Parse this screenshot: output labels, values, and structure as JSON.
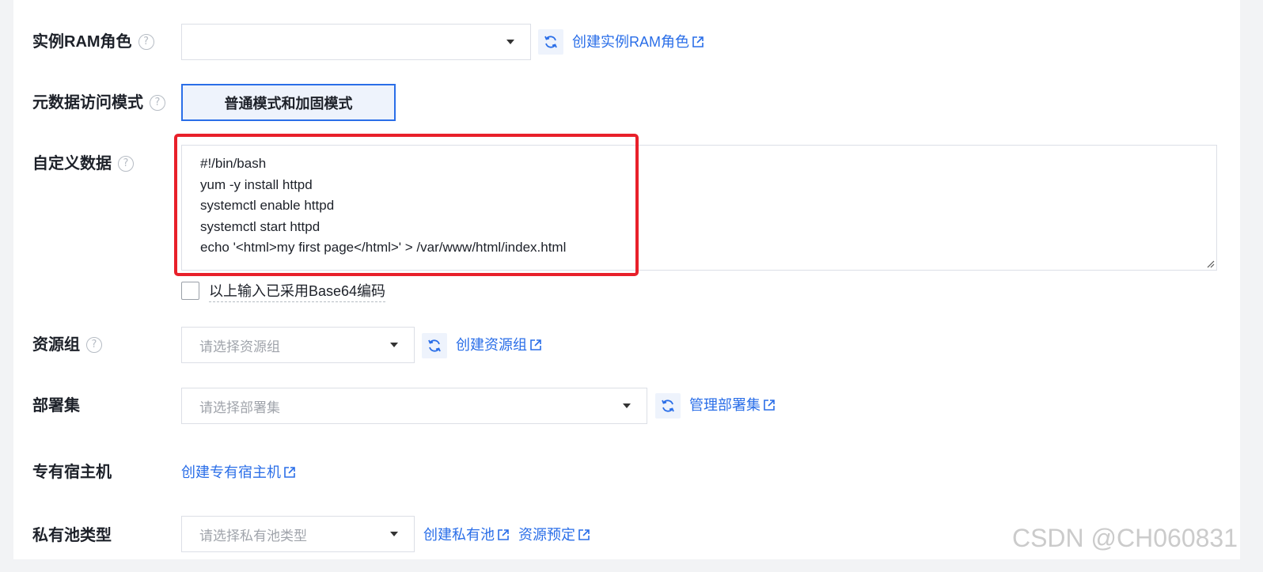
{
  "ram_role": {
    "label": "实例RAM角色",
    "value": "",
    "create_link": "创建实例RAM角色"
  },
  "metadata_mode": {
    "label": "元数据访问模式",
    "button_label": "普通模式和加固模式"
  },
  "user_data": {
    "label": "自定义数据",
    "lines": [
      "#!/bin/bash",
      "yum -y install httpd",
      "systemctl enable httpd",
      "systemctl start httpd",
      "echo '<html>my first page</html>' > /var/www/html/index.html"
    ],
    "base64_checkbox_label": "以上输入已采用Base64编码",
    "base64_checked": false
  },
  "resource_group": {
    "label": "资源组",
    "placeholder": "请选择资源组",
    "create_link": "创建资源组"
  },
  "deployment_set": {
    "label": "部署集",
    "placeholder": "请选择部署集",
    "manage_link": "管理部署集"
  },
  "dedicated_host": {
    "label": "专有宿主机",
    "create_link": "创建专有宿主机"
  },
  "private_pool": {
    "label": "私有池类型",
    "placeholder": "请选择私有池类型",
    "create_link": "创建私有池",
    "reserve_link": "资源预定"
  },
  "watermark": "CSDN @CH060831",
  "colors": {
    "link": "#2a6ee8",
    "highlight": "#e8202a",
    "active_border": "#2a6ee8"
  }
}
